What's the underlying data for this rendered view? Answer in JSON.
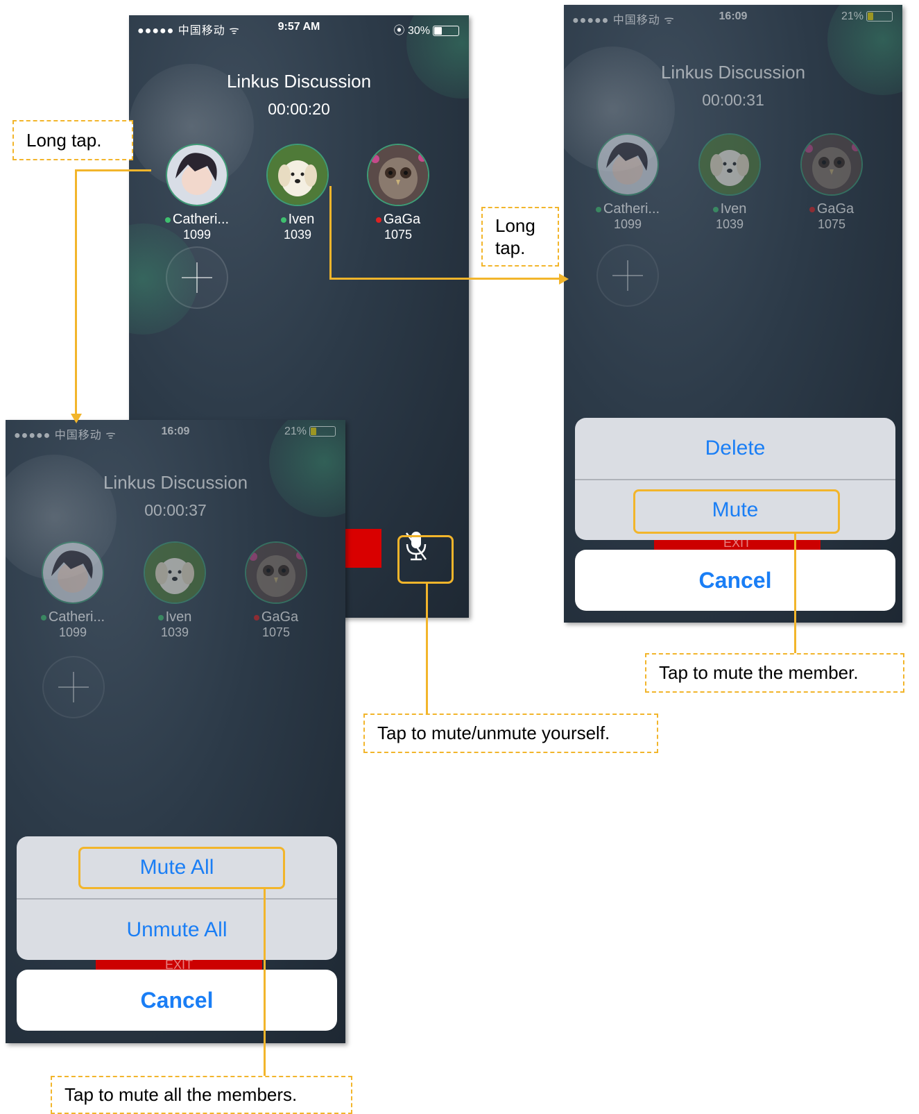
{
  "screens": {
    "main": {
      "carrier": "●●●●● 中国移动 ᯤ",
      "time": "9:57 AM",
      "battery": "⦿ 30%",
      "title": "Linkus Discussion",
      "timer": "00:00:20"
    },
    "mute_member": {
      "carrier": "●●●●● 中国移动 ᯤ",
      "time": "16:09",
      "battery": "21%",
      "title": "Linkus Discussion",
      "timer": "00:00:31",
      "sheet": {
        "delete": "Delete",
        "mute": "Mute",
        "exit": "EXIT",
        "cancel": "Cancel"
      }
    },
    "mute_all": {
      "carrier": "●●●●● 中国移动 ᯤ",
      "time": "16:09",
      "battery": "21%",
      "title": "Linkus Discussion",
      "timer": "00:00:37",
      "sheet": {
        "mute_all": "Mute All",
        "unmute_all": "Unmute All",
        "exit": "EXIT",
        "cancel": "Cancel"
      }
    }
  },
  "members": [
    {
      "name": "Catheri...",
      "ext": "1099",
      "status_color": "#3fbf6f"
    },
    {
      "name": "Iven",
      "ext": "1039",
      "status_color": "#3fbf6f"
    },
    {
      "name": "GaGa",
      "ext": "1075",
      "status_color": "#d22"
    }
  ],
  "annotations": {
    "long_tap_left": "Long tap.",
    "long_tap_right": "Long tap.",
    "mute_member": "Tap to mute the member.",
    "mute_self": "Tap to mute/unmute yourself.",
    "mute_all": "Tap to mute all the members."
  },
  "colors": {
    "accent": "#f2b52b",
    "ios_blue": "#1a7ef5",
    "exit_red": "#c00"
  }
}
